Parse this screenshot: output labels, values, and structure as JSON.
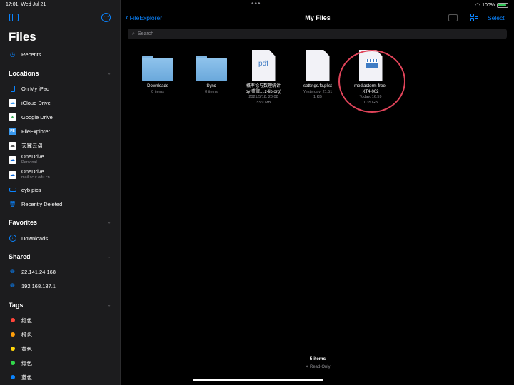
{
  "status": {
    "time": "17:01",
    "date": "Wed Jul 21",
    "battery": "100%",
    "battery_level": 1.0
  },
  "sidebar": {
    "title": "Files",
    "recents": "Recents",
    "locations_header": "Locations",
    "locations": [
      {
        "label": "On My iPad",
        "icon": "ipad-icon"
      },
      {
        "label": "iCloud Drive",
        "icon": "icloud-icon"
      },
      {
        "label": "Google Drive",
        "icon": "google-drive-icon"
      },
      {
        "label": "FileExplorer",
        "icon": "fileexplorer-icon",
        "badge": "FE"
      },
      {
        "label": "天翼云盘",
        "icon": "cloud-icon"
      },
      {
        "label": "OneDrive",
        "sub": "Personal",
        "icon": "onedrive-icon"
      },
      {
        "label": "OneDrive",
        "sub": "mail.scut.edu.cn",
        "icon": "onedrive-icon"
      },
      {
        "label": "qyb pics",
        "icon": "drive-icon"
      },
      {
        "label": "Recently Deleted",
        "icon": "trash-icon"
      }
    ],
    "favorites_header": "Favorites",
    "favorites": [
      {
        "label": "Downloads",
        "icon": "download-icon"
      }
    ],
    "shared_header": "Shared",
    "shared": [
      {
        "label": "22.141.24.168",
        "icon": "globe-icon"
      },
      {
        "label": "192.168.137.1",
        "icon": "globe-icon"
      }
    ],
    "tags_header": "Tags",
    "tags": [
      {
        "label": "红色",
        "color": "#ff453a"
      },
      {
        "label": "橙色",
        "color": "#ff9f0a"
      },
      {
        "label": "黄色",
        "color": "#ffd60a"
      },
      {
        "label": "绿色",
        "color": "#32d74b"
      },
      {
        "label": "蓝色",
        "color": "#0a84ff"
      }
    ]
  },
  "main": {
    "back_label": "FileExplorer",
    "title": "My Files",
    "select_label": "Select",
    "search_placeholder": "Search",
    "files": [
      {
        "name": "Downloads",
        "meta1": "0 items",
        "kind": "folder"
      },
      {
        "name": "Sync",
        "meta1": "0 items",
        "kind": "folder"
      },
      {
        "name": "概率论与数理统计",
        "name2": "by 盛骤,...z-lib.org)",
        "meta1": "2021/5/18, 20:08",
        "meta2": "33.9 MB",
        "kind": "pdf",
        "thumb_text": "pdf"
      },
      {
        "name": "settings.fe.plist",
        "meta1": "Yesterday, 21:51",
        "meta2": "1 KB",
        "kind": "doc"
      },
      {
        "name": "mediastorm-free-",
        "name2": "XT4-002",
        "meta1": "Today, 16:59",
        "meta2": "1.35 GB",
        "kind": "video"
      }
    ],
    "footer_count": "5 items",
    "footer_readonly": "✕ Read-Only"
  },
  "colors": {
    "accent": "#0a84ff",
    "highlight": "#e0445a"
  }
}
